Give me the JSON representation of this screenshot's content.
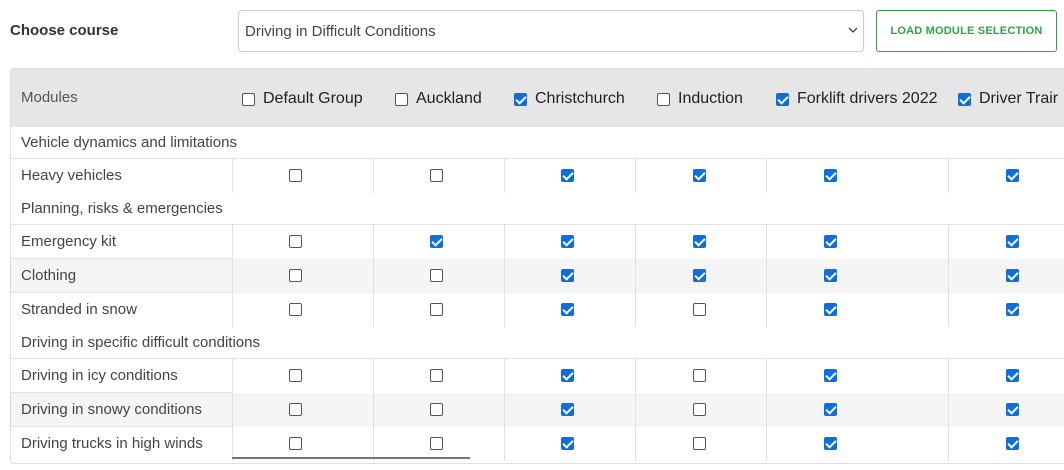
{
  "header": {
    "choose_label": "Choose course",
    "selected_course": "Driving in Difficult Conditions",
    "load_button": "LOAD MODULE SELECTION"
  },
  "table": {
    "modules_header": "Modules",
    "groups": [
      {
        "label": "Default Group",
        "checked": false
      },
      {
        "label": "Auckland",
        "checked": false
      },
      {
        "label": "Christchurch",
        "checked": true
      },
      {
        "label": "Induction",
        "checked": false
      },
      {
        "label": "Forklift drivers 2022",
        "checked": true
      },
      {
        "label": "Driver Trair",
        "checked": true
      }
    ],
    "sections": [
      {
        "title": "Vehicle dynamics and limitations",
        "rows": [
          {
            "name": "Heavy vehicles",
            "values": [
              false,
              false,
              true,
              true,
              true,
              true
            ]
          }
        ]
      },
      {
        "title": "Planning, risks & emergencies",
        "rows": [
          {
            "name": "Emergency kit",
            "values": [
              false,
              true,
              true,
              true,
              true,
              true
            ]
          },
          {
            "name": "Clothing",
            "values": [
              false,
              false,
              true,
              true,
              true,
              true
            ]
          },
          {
            "name": "Stranded in snow",
            "values": [
              false,
              false,
              true,
              false,
              true,
              true
            ]
          }
        ]
      },
      {
        "title": "Driving in specific difficult conditions",
        "rows": [
          {
            "name": "Driving in icy conditions",
            "values": [
              false,
              false,
              true,
              false,
              true,
              true
            ]
          },
          {
            "name": "Driving in snowy conditions",
            "values": [
              false,
              false,
              true,
              false,
              true,
              true
            ]
          },
          {
            "name": "Driving trucks in high winds",
            "values": [
              false,
              false,
              true,
              false,
              true,
              true
            ]
          }
        ]
      }
    ]
  },
  "colors": {
    "accent_green": "#28a745",
    "checkbox_blue": "#0b6fdf",
    "header_bg": "#e6e6e6"
  }
}
